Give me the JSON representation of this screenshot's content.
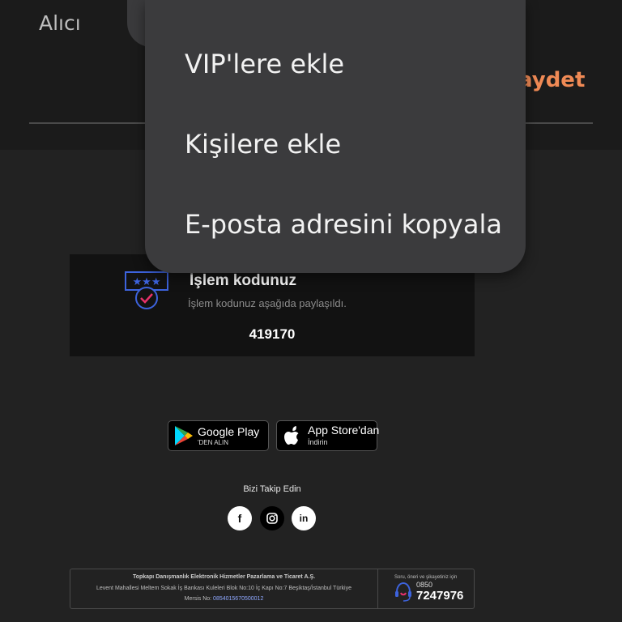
{
  "header": {
    "recipient_label": "Alıcı",
    "save_label": "aydet"
  },
  "menu": {
    "items": [
      {
        "label": "VIP'lere ekle"
      },
      {
        "label": "Kişilere ekle"
      },
      {
        "label": "E-posta adresini kopyala"
      }
    ]
  },
  "code_card": {
    "icon": "verified-code-icon",
    "title": "İşlem kodunuz",
    "description": "İşlem kodunuz aşağıda paylaşıldı.",
    "code": "419170"
  },
  "stores": {
    "google_play": {
      "line1": "Google Play",
      "line2": "'DEN ALIN",
      "icon": "google-play-icon"
    },
    "app_store": {
      "line1": "App Store'dan",
      "line2": "İndirin",
      "icon": "apple-icon"
    }
  },
  "social": {
    "title": "Bizi Takip Edin",
    "facebook": "f",
    "linkedin": "in",
    "icons": [
      "facebook-icon",
      "instagram-icon",
      "linkedin-icon"
    ]
  },
  "footer": {
    "company": "Topkapı Danışmanlık Elektronik Hizmetler Pazarlama ve Ticaret A.Ş.",
    "address": "Levent Mahallesi Meltem Sokak İş Bankası Kuleleri Blok No:10 İç Kapı No:7 Beşiktaş/İstanbul Türkiye",
    "mersis_label": "Mersis No: ",
    "mersis_number": "0854015670500012",
    "support_title": "Soru, öneri ve şikayetiniz için",
    "phone_prefix": "0850",
    "phone_number": "7247976"
  },
  "colors": {
    "background": "#222222",
    "menu_background": "#3b3b3d",
    "accent": "#f08a55",
    "icon_blue": "#3d63dd",
    "icon_red": "#e8316b"
  }
}
